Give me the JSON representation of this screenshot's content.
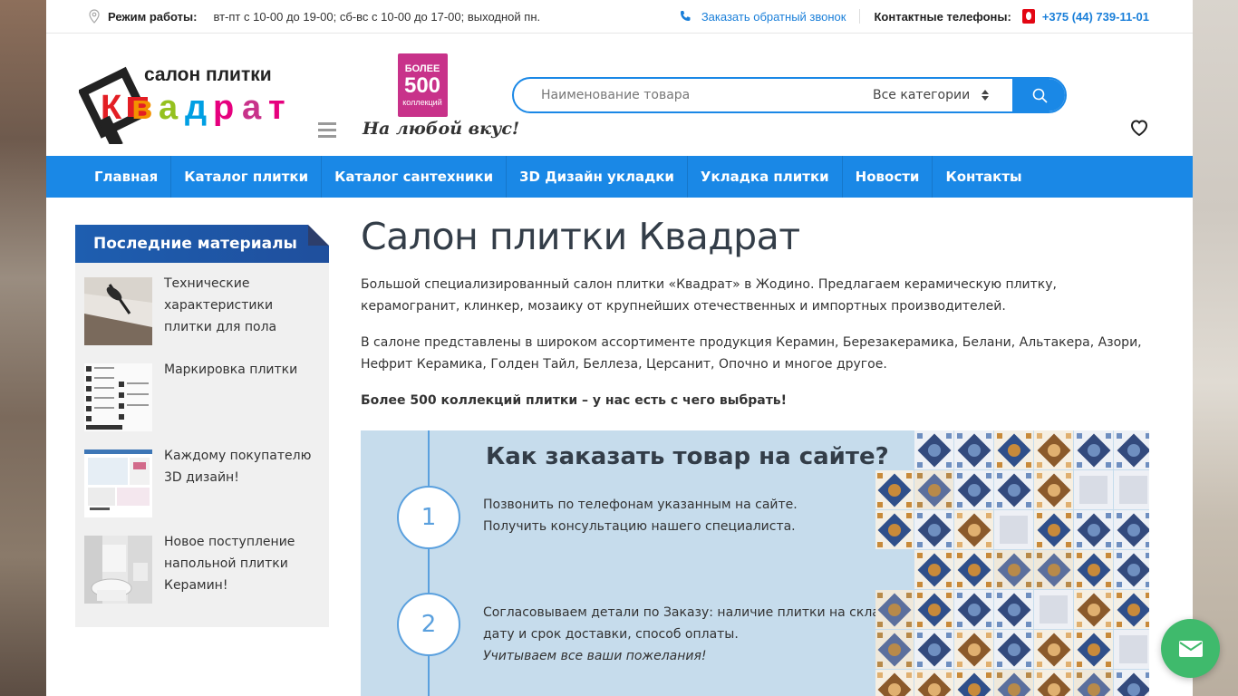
{
  "topbar": {
    "hours_label": "Режим работы:",
    "hours_value": "вт-пт с 10-00 до 19-00; сб-вс с 10-00 до 17-00; выходной пн.",
    "callback_label": "Заказать обратный звонок",
    "contacts_label": "Контактные телефоны:",
    "phone": "+375 (44) 739-11-01"
  },
  "header": {
    "logo_top": "салон плитки",
    "logo_bottom": "Квадрат",
    "promo": {
      "line1": "БОЛЕЕ",
      "line2": "500",
      "line3": "коллекций",
      "slogan": "На любой вкус!"
    },
    "search": {
      "placeholder": "Наименование товара",
      "category_selected": "Все категории"
    }
  },
  "nav": {
    "items": [
      {
        "label": "Главная"
      },
      {
        "label": "Каталог плитки"
      },
      {
        "label": "Каталог сантехники"
      },
      {
        "label": "3D Дизайн укладки"
      },
      {
        "label": "Укладка плитки"
      },
      {
        "label": "Новости"
      },
      {
        "label": "Контакты"
      }
    ]
  },
  "sidebar": {
    "title": "Последние материалы",
    "items": [
      {
        "title": "Технические характеристики плитки для пола"
      },
      {
        "title": "Маркировка плитки"
      },
      {
        "title": "Каждому покупателю 3D дизайн!"
      },
      {
        "title": "Новое поступление напольной плитки Керамин!"
      }
    ]
  },
  "main": {
    "title": "Салон плитки Квадрат",
    "paragraphs": [
      "Большой специализированный салон плитки «Квадрат» в Жодино. Предлагаем керамическую плитку, керамогранит, клинкер, мозаику от крупнейших отечественных и импортных производителей.",
      "В салоне представлены в широком ассортименте продукция Керамин, Березакерамика, Белани, Альтакера, Азори, Нефрит Керамика, Голден Тайл, Беллеза, Церсанит, Опочно и многое другое."
    ],
    "highlight": "Более 500 коллекций плитки – у нас есть с чего выбрать!",
    "order": {
      "title": "Как заказать товар на сайте?",
      "steps": [
        {
          "num": "1",
          "line1": "Позвонить по телефонам указанным на сайте.",
          "line2": "Получить консультацию нашего специалиста.",
          "note": ""
        },
        {
          "num": "2",
          "line1": "Согласовываем детали по Заказу: наличие плитки на складе,",
          "line2": "дату и срок доставки, способ оплаты.",
          "note": "Учитываем все ваши пожелания!"
        }
      ]
    }
  },
  "colors": {
    "accent": "#1a88e6",
    "sidebar_head": "#1f5baa",
    "order_bg": "#c6dcec",
    "fab": "#3fba6c",
    "promo": "#c8328a"
  }
}
